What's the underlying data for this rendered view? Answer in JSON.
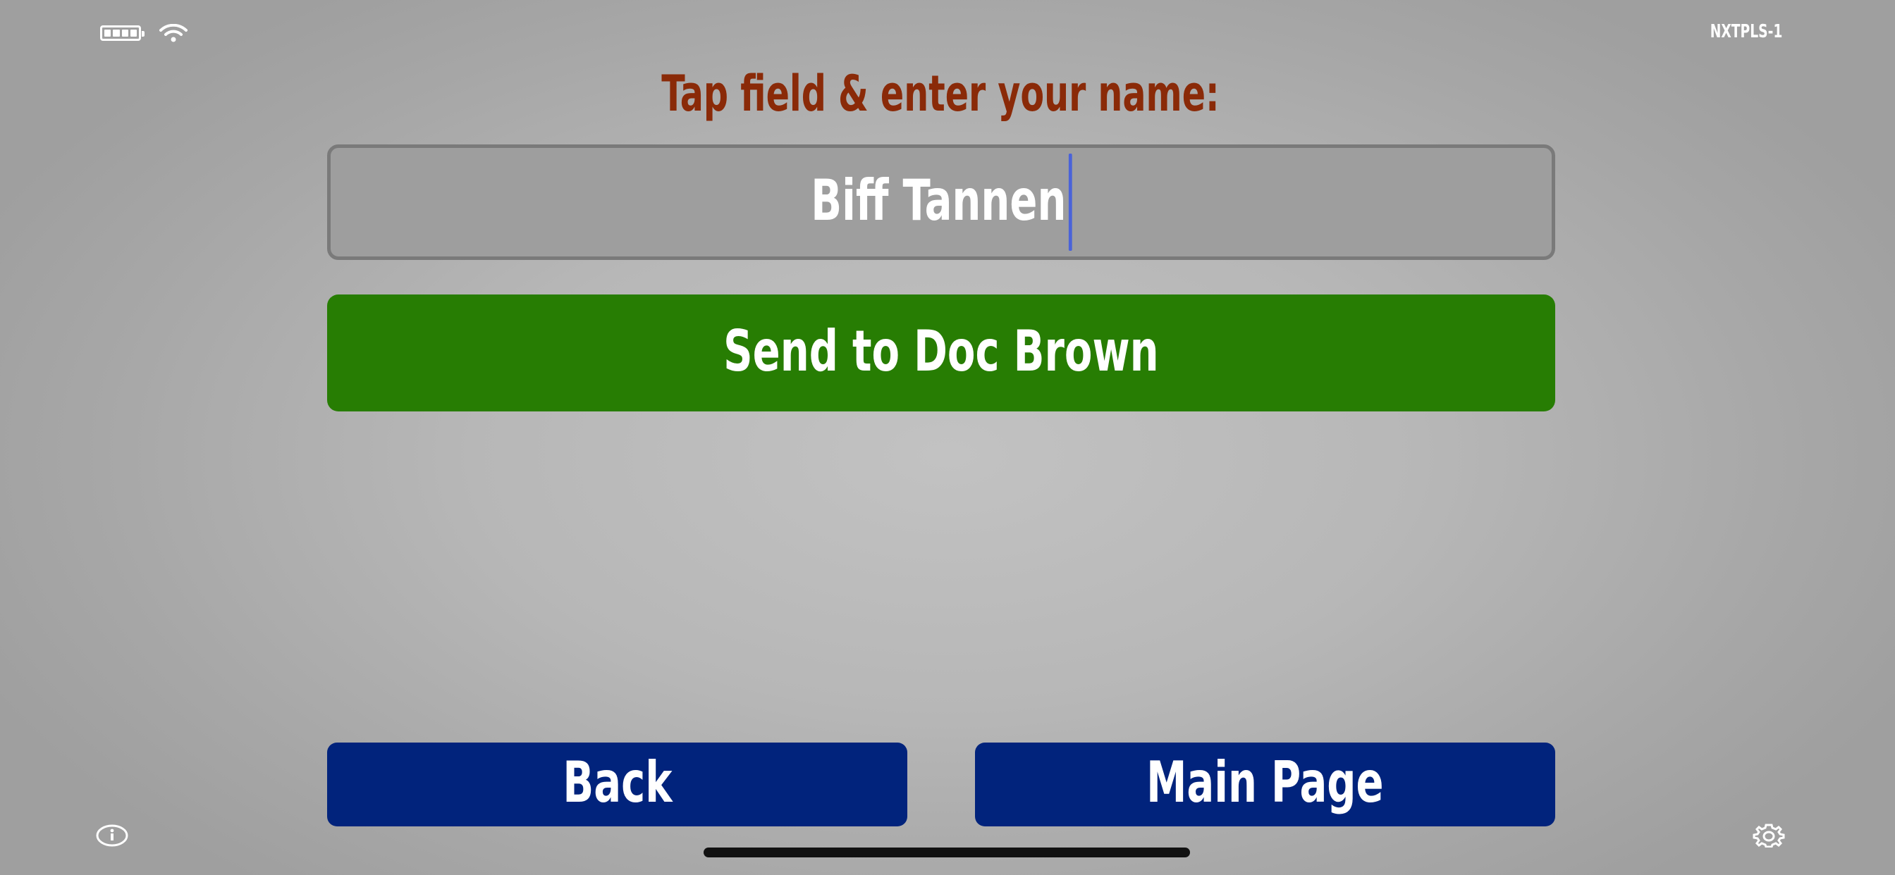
{
  "status_bar": {
    "battery_icon": "battery-full-icon",
    "wifi_icon": "wifi-icon",
    "device_id": "NXTPLS-1"
  },
  "prompt": "Tap field & enter your name:",
  "name_field": {
    "value": "Biff Tannen"
  },
  "send_button": {
    "label": "Send to Doc Brown"
  },
  "nav": {
    "back_label": "Back",
    "main_label": "Main Page"
  },
  "footer": {
    "info_icon": "info-icon",
    "settings_icon": "gear-icon"
  },
  "colors": {
    "prompt": "#8a2a08",
    "send_button": "#277d03",
    "nav_button": "#01237c",
    "caret": "#4a63d9",
    "field_background": "#9e9e9e"
  }
}
